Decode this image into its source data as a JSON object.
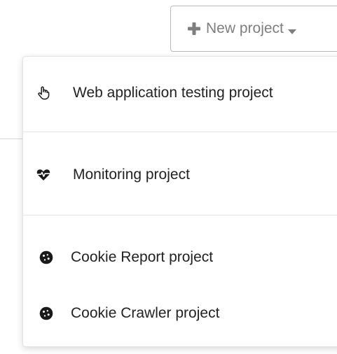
{
  "new_project_button": {
    "label": "New project",
    "plus_icon": "plus-icon",
    "caret_icon": "caret-down-icon"
  },
  "menu": {
    "items": [
      {
        "label": "Web application testing project",
        "icon": "hand-pointer-icon"
      },
      {
        "label": "Monitoring project",
        "icon": "heartbeat-icon"
      },
      {
        "label": "Cookie Report project",
        "icon": "cookie-icon"
      },
      {
        "label": "Cookie Crawler project",
        "icon": "cookie-icon"
      }
    ]
  },
  "colors": {
    "button_text": "#7e7e7e",
    "menu_text": "#222222",
    "icon": "#1a1a1a"
  }
}
